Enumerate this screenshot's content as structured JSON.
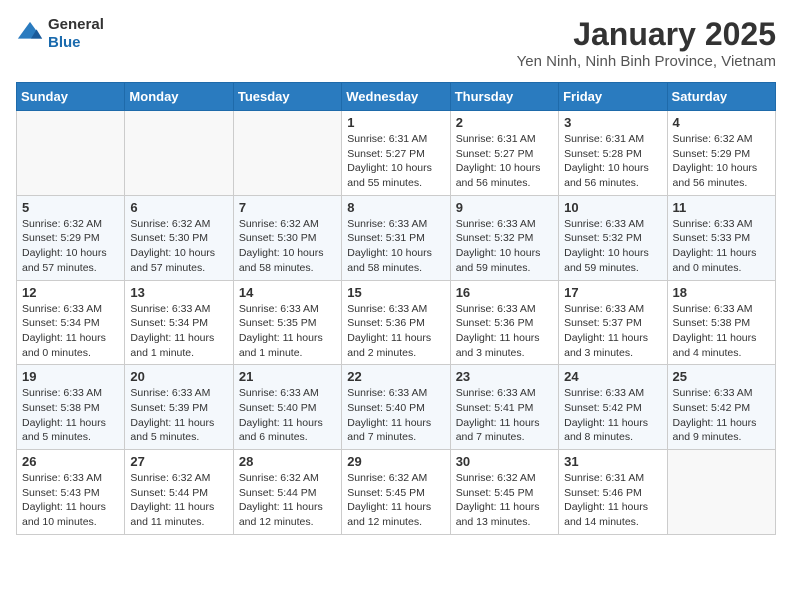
{
  "header": {
    "logo": {
      "general": "General",
      "blue": "Blue"
    },
    "title": "January 2025",
    "subtitle": "Yen Ninh, Ninh Binh Province, Vietnam"
  },
  "weekdays": [
    "Sunday",
    "Monday",
    "Tuesday",
    "Wednesday",
    "Thursday",
    "Friday",
    "Saturday"
  ],
  "weeks": [
    [
      {
        "day": "",
        "info": ""
      },
      {
        "day": "",
        "info": ""
      },
      {
        "day": "",
        "info": ""
      },
      {
        "day": "1",
        "info": "Sunrise: 6:31 AM\nSunset: 5:27 PM\nDaylight: 10 hours\nand 55 minutes."
      },
      {
        "day": "2",
        "info": "Sunrise: 6:31 AM\nSunset: 5:27 PM\nDaylight: 10 hours\nand 56 minutes."
      },
      {
        "day": "3",
        "info": "Sunrise: 6:31 AM\nSunset: 5:28 PM\nDaylight: 10 hours\nand 56 minutes."
      },
      {
        "day": "4",
        "info": "Sunrise: 6:32 AM\nSunset: 5:29 PM\nDaylight: 10 hours\nand 56 minutes."
      }
    ],
    [
      {
        "day": "5",
        "info": "Sunrise: 6:32 AM\nSunset: 5:29 PM\nDaylight: 10 hours\nand 57 minutes."
      },
      {
        "day": "6",
        "info": "Sunrise: 6:32 AM\nSunset: 5:30 PM\nDaylight: 10 hours\nand 57 minutes."
      },
      {
        "day": "7",
        "info": "Sunrise: 6:32 AM\nSunset: 5:30 PM\nDaylight: 10 hours\nand 58 minutes."
      },
      {
        "day": "8",
        "info": "Sunrise: 6:33 AM\nSunset: 5:31 PM\nDaylight: 10 hours\nand 58 minutes."
      },
      {
        "day": "9",
        "info": "Sunrise: 6:33 AM\nSunset: 5:32 PM\nDaylight: 10 hours\nand 59 minutes."
      },
      {
        "day": "10",
        "info": "Sunrise: 6:33 AM\nSunset: 5:32 PM\nDaylight: 10 hours\nand 59 minutes."
      },
      {
        "day": "11",
        "info": "Sunrise: 6:33 AM\nSunset: 5:33 PM\nDaylight: 11 hours\nand 0 minutes."
      }
    ],
    [
      {
        "day": "12",
        "info": "Sunrise: 6:33 AM\nSunset: 5:34 PM\nDaylight: 11 hours\nand 0 minutes."
      },
      {
        "day": "13",
        "info": "Sunrise: 6:33 AM\nSunset: 5:34 PM\nDaylight: 11 hours\nand 1 minute."
      },
      {
        "day": "14",
        "info": "Sunrise: 6:33 AM\nSunset: 5:35 PM\nDaylight: 11 hours\nand 1 minute."
      },
      {
        "day": "15",
        "info": "Sunrise: 6:33 AM\nSunset: 5:36 PM\nDaylight: 11 hours\nand 2 minutes."
      },
      {
        "day": "16",
        "info": "Sunrise: 6:33 AM\nSunset: 5:36 PM\nDaylight: 11 hours\nand 3 minutes."
      },
      {
        "day": "17",
        "info": "Sunrise: 6:33 AM\nSunset: 5:37 PM\nDaylight: 11 hours\nand 3 minutes."
      },
      {
        "day": "18",
        "info": "Sunrise: 6:33 AM\nSunset: 5:38 PM\nDaylight: 11 hours\nand 4 minutes."
      }
    ],
    [
      {
        "day": "19",
        "info": "Sunrise: 6:33 AM\nSunset: 5:38 PM\nDaylight: 11 hours\nand 5 minutes."
      },
      {
        "day": "20",
        "info": "Sunrise: 6:33 AM\nSunset: 5:39 PM\nDaylight: 11 hours\nand 5 minutes."
      },
      {
        "day": "21",
        "info": "Sunrise: 6:33 AM\nSunset: 5:40 PM\nDaylight: 11 hours\nand 6 minutes."
      },
      {
        "day": "22",
        "info": "Sunrise: 6:33 AM\nSunset: 5:40 PM\nDaylight: 11 hours\nand 7 minutes."
      },
      {
        "day": "23",
        "info": "Sunrise: 6:33 AM\nSunset: 5:41 PM\nDaylight: 11 hours\nand 7 minutes."
      },
      {
        "day": "24",
        "info": "Sunrise: 6:33 AM\nSunset: 5:42 PM\nDaylight: 11 hours\nand 8 minutes."
      },
      {
        "day": "25",
        "info": "Sunrise: 6:33 AM\nSunset: 5:42 PM\nDaylight: 11 hours\nand 9 minutes."
      }
    ],
    [
      {
        "day": "26",
        "info": "Sunrise: 6:33 AM\nSunset: 5:43 PM\nDaylight: 11 hours\nand 10 minutes."
      },
      {
        "day": "27",
        "info": "Sunrise: 6:32 AM\nSunset: 5:44 PM\nDaylight: 11 hours\nand 11 minutes."
      },
      {
        "day": "28",
        "info": "Sunrise: 6:32 AM\nSunset: 5:44 PM\nDaylight: 11 hours\nand 12 minutes."
      },
      {
        "day": "29",
        "info": "Sunrise: 6:32 AM\nSunset: 5:45 PM\nDaylight: 11 hours\nand 12 minutes."
      },
      {
        "day": "30",
        "info": "Sunrise: 6:32 AM\nSunset: 5:45 PM\nDaylight: 11 hours\nand 13 minutes."
      },
      {
        "day": "31",
        "info": "Sunrise: 6:31 AM\nSunset: 5:46 PM\nDaylight: 11 hours\nand 14 minutes."
      },
      {
        "day": "",
        "info": ""
      }
    ]
  ]
}
